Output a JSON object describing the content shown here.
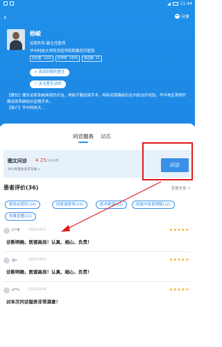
{
  "status_bar": {
    "time": "11:44"
  },
  "header": {
    "share_label": "分享",
    "doctor": {
      "name": "杨峻",
      "title": "泌尿外科  副主任医师",
      "hospital": "华中科技大学同济医学院附属同济医院",
      "stats": [
        {
          "label": "问诊量",
          "value": "1206"
        },
        {
          "label": "好评率",
          "value": "100%"
        },
        {
          "label": "粉丝数",
          "value": "15"
        }
      ]
    },
    "add_doctor_label": "+ 添加到我的医生",
    "follow_label": "☆ 关注医生动态",
    "intro": {
      "specialty": "【擅长】擅长泌尿系统疾病的诊治，熟练开展泌尿手术，特别对尿路结石在内的治疗经验，华中地区首例开展泌尿系统结合显微手术。",
      "specialty_cont": "的治疗经验，华中地区首批开展泌尿外科微创腔镜手术。",
      "bio": "【简介】华中科技大..."
    }
  },
  "tabs": [
    {
      "label": "问诊服务",
      "active": true
    },
    {
      "label": "动态",
      "active": false
    }
  ],
  "service": {
    "title": "图文问诊",
    "price": "¥ 25",
    "unit": "/24小时",
    "note": "24小时医生多次沟通 >",
    "button_label": "问诊"
  },
  "reviews": {
    "heading": "患者评价(36)",
    "see_all": "查看全部 >",
    "tags": [
      "服务态度好(24)",
      "回复速度快(15)",
      "医术精湛(12)",
      "回复内容易理解(22)",
      "效果显著(12)"
    ],
    "items": [
      {
        "user": "C**E",
        "date": "2021/11/11",
        "stars": "★★★★★",
        "text": "诊断明确，医德高尚！认真、细心、负责！"
      },
      {
        "user": "孙*",
        "date": "2021/11/07",
        "stars": "★★★★★",
        "text": "诊断明确，医德高尚！认真、细心、负责！"
      },
      {
        "user": "a**x",
        "date": "2021/10/26",
        "stars": "★★★★★",
        "text": "对本次问诊服务非常满意！"
      }
    ]
  },
  "colors": {
    "primary": "#1f8fe8",
    "highlight": "#e01818",
    "star": "#f5a623",
    "price": "#e53935"
  }
}
